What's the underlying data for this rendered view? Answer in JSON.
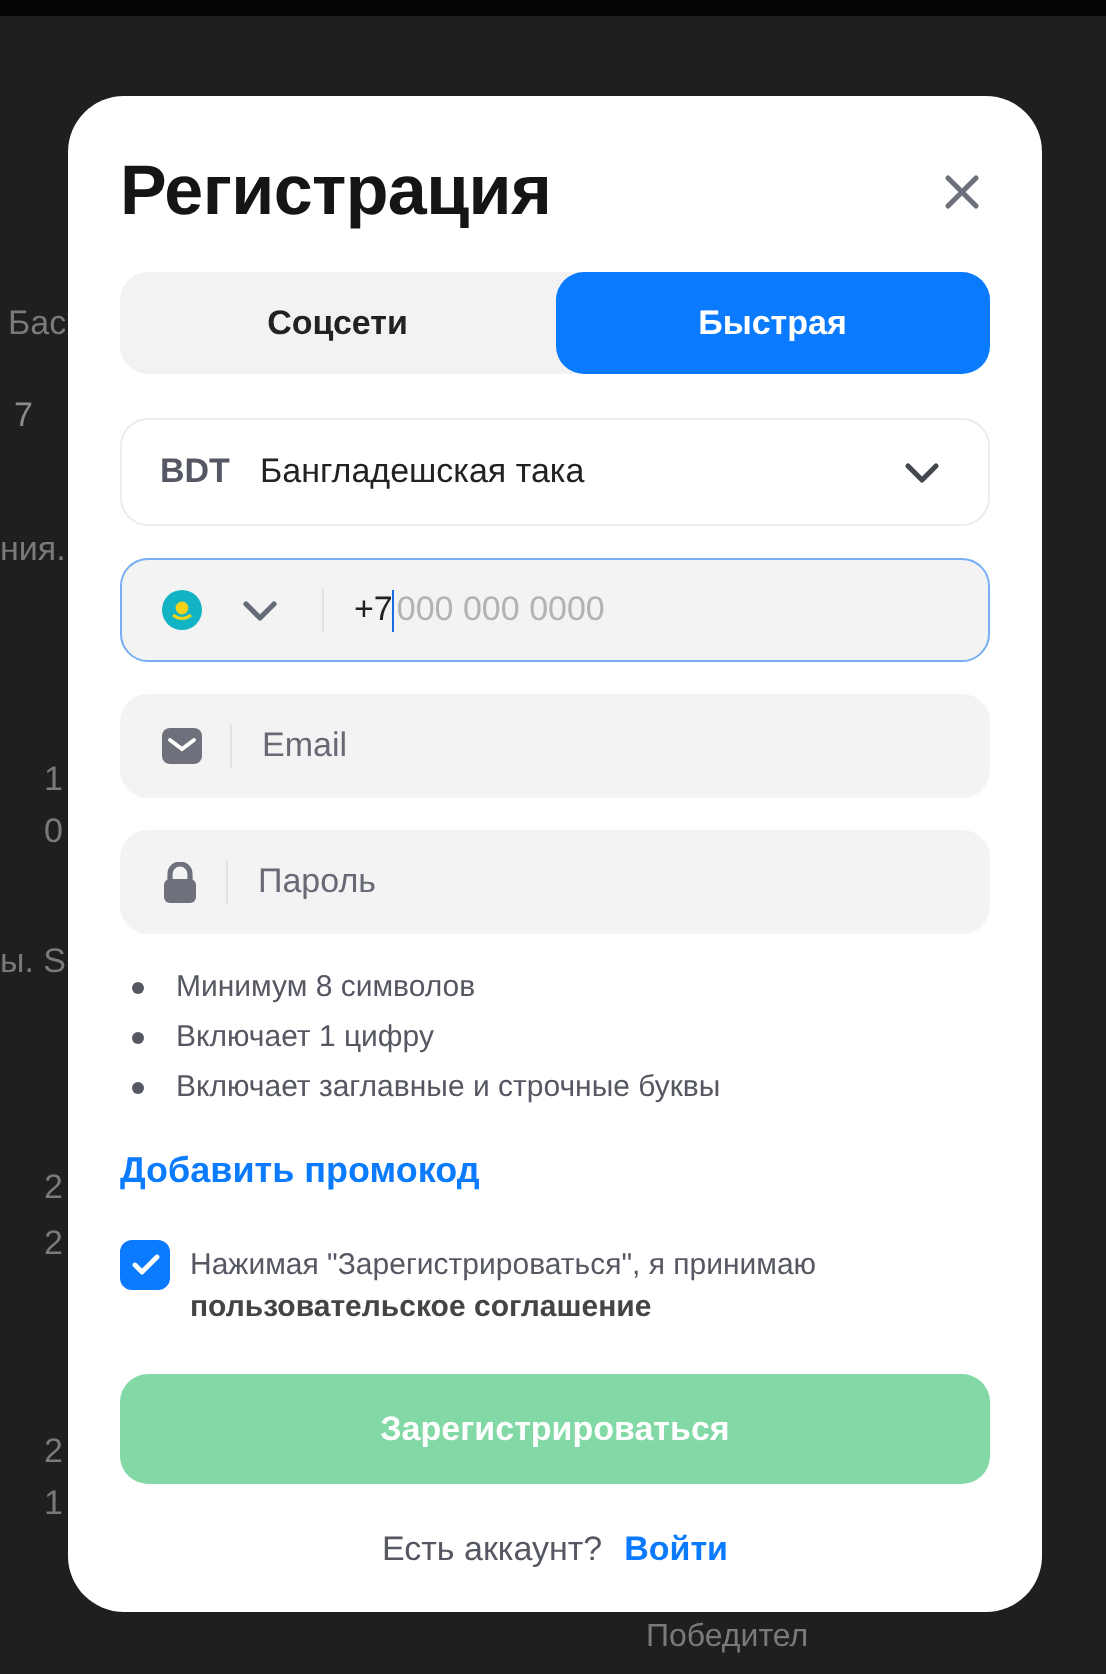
{
  "background": {
    "fragments": [
      {
        "text": "Бас"
      },
      {
        "text": "7"
      },
      {
        "text": "ния."
      },
      {
        "text": "1"
      },
      {
        "text": "0"
      },
      {
        "text": "ы. S"
      },
      {
        "text": "2"
      },
      {
        "text": "2"
      },
      {
        "text": "2"
      },
      {
        "text": "1"
      }
    ],
    "bottom_text": "Победител"
  },
  "dialog": {
    "title": "Регистрация",
    "tabs": [
      {
        "label": "Соцсети",
        "selected": false
      },
      {
        "label": "Быстрая",
        "selected": true
      }
    ],
    "currency": {
      "code": "BDT",
      "name": "Бангладешская така"
    },
    "phone": {
      "value": "+7",
      "placeholder": "000 000 0000",
      "focused": true
    },
    "email": {
      "placeholder": "Email",
      "focused": false
    },
    "password": {
      "placeholder": "Пароль",
      "focused": false
    },
    "password_rules": [
      "Минимум 8 символов",
      "Включает 1 цифру",
      "Включает заглавные и строчные буквы"
    ],
    "promo_link": "Добавить промокод",
    "agreement": {
      "checked": true,
      "text": "Нажимая \"Зарегистрироваться\", я принимаю **пользовательское соглашение**"
    },
    "submit": {
      "label": "Зарегистрироваться",
      "disabled": true
    },
    "login_prompt": {
      "text": "Есть аккаунт?",
      "link": "Войти"
    }
  }
}
